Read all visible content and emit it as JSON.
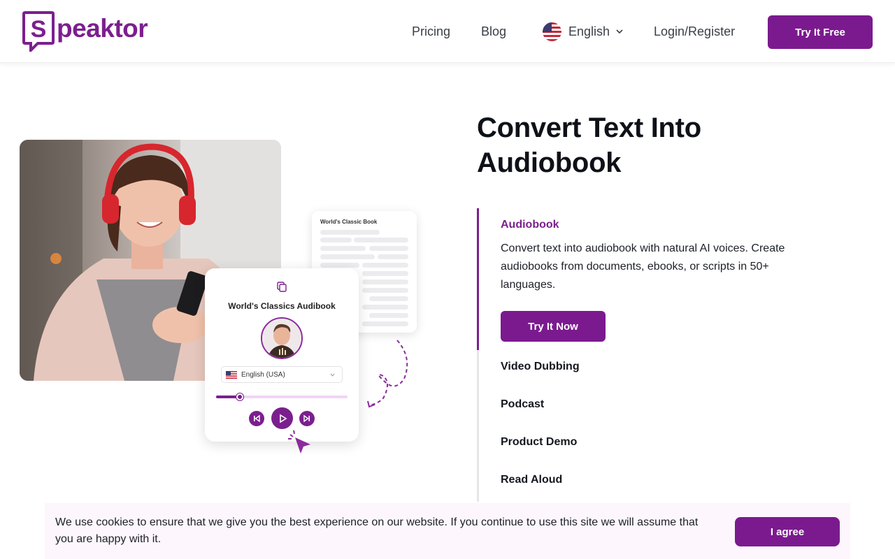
{
  "header": {
    "brand": "Speaktor",
    "brand_letter": "S",
    "nav": {
      "pricing": "Pricing",
      "blog": "Blog",
      "login": "Login/Register"
    },
    "language": {
      "label": "English",
      "flag_icon": "us-flag-icon"
    },
    "cta": "Try It Free"
  },
  "illustration": {
    "book_card_title": "World's Classic Book",
    "player_title": "World's Classics Audibook",
    "language_select": "English (USA)",
    "progress": 0.18
  },
  "hero": {
    "title": "Convert Text Into Audiobook",
    "tabs": {
      "active": {
        "label": "Audiobook",
        "description": "Convert text into audiobook with natural AI voices. Create audiobooks from documents, ebooks, or scripts in 50+ languages.",
        "cta": "Try It Now"
      },
      "items": [
        "Video Dubbing",
        "Podcast",
        "Product Demo",
        "Read Aloud"
      ]
    }
  },
  "cookie": {
    "text": "We use cookies to ensure that we give you the best experience on our website. If you continue to use this site we will assume that you are happy with it.",
    "accept": "I agree"
  },
  "colors": {
    "brand": "#7b1f8e",
    "cookie_bg": "#fdf6fd"
  }
}
